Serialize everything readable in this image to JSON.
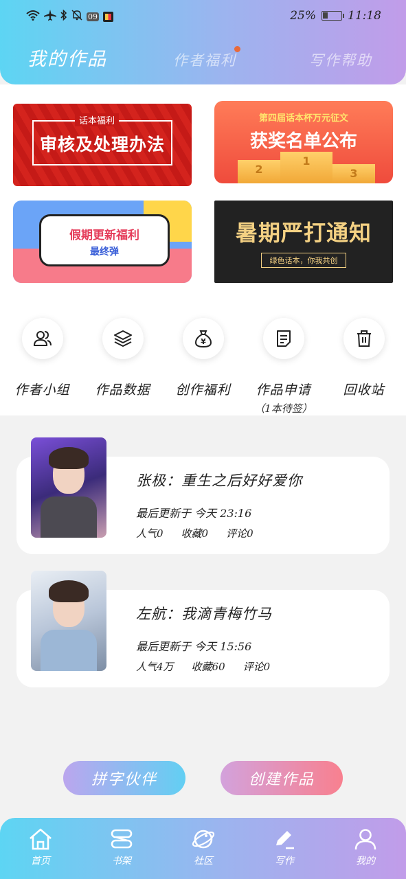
{
  "status_bar": {
    "badge": "09",
    "battery": "25%",
    "time": "11:18"
  },
  "tabs": [
    {
      "label": "我的作品",
      "active": true
    },
    {
      "label": "作者福利",
      "active": false,
      "has_dot": true
    },
    {
      "label": "写作帮助",
      "active": false
    }
  ],
  "banners": {
    "review": {
      "tag": "话本福利",
      "title": "审核及处理办法"
    },
    "award": {
      "subtitle": "第四届话本杯万元征文",
      "title": "获奖名单公布",
      "podium": [
        "2",
        "1",
        "3"
      ]
    },
    "holiday": {
      "title": "假期更新福利",
      "subtitle": "最终弹"
    },
    "summer": {
      "title": "暑期严打通知",
      "subtitle": "绿色话本，你我共创"
    }
  },
  "shortcuts": [
    {
      "label": "作者小组",
      "icon": "users-icon"
    },
    {
      "label": "作品数据",
      "icon": "layers-icon"
    },
    {
      "label": "创作福利",
      "icon": "money-bag-icon"
    },
    {
      "label": "作品申请",
      "icon": "document-icon",
      "note": "（1本待签）"
    },
    {
      "label": "回收站",
      "icon": "trash-icon"
    }
  ],
  "works": [
    {
      "title": "张极：重生之后好好爱你",
      "updated": "最后更新于 今天 23:16",
      "popularity": "人气0",
      "favorites": "收藏0",
      "comments": "评论0"
    },
    {
      "title": "左航：我滴青梅竹马",
      "updated": "最后更新于 今天 15:56",
      "popularity": "人气4万",
      "favorites": "收藏60",
      "comments": "评论0"
    }
  ],
  "actions": {
    "partner": "拼字伙伴",
    "create": "创建作品"
  },
  "bottom_nav": [
    {
      "label": "首页",
      "icon": "home-icon"
    },
    {
      "label": "书架",
      "icon": "bookshelf-icon"
    },
    {
      "label": "社区",
      "icon": "planet-icon"
    },
    {
      "label": "写作",
      "icon": "pen-icon"
    },
    {
      "label": "我的",
      "icon": "profile-icon"
    }
  ],
  "colors": {
    "header_gradient_start": "#5dd5f3",
    "header_gradient_end": "#c19ce9",
    "notification_dot": "#e86a3b",
    "create_button": "#f8808f",
    "partner_button": "#62cff3"
  }
}
